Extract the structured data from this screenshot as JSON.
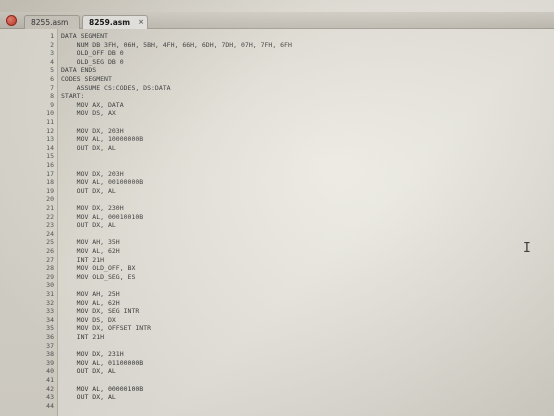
{
  "tabs": [
    {
      "label": "8255.asm"
    },
    {
      "label": "8259.asm",
      "active": true
    }
  ],
  "lines": [
    {
      "n": "1",
      "text": "DATA SEGMENT"
    },
    {
      "n": "2",
      "text": "    NUM DB 3FH, 06H, 5BH, 4FH, 66H, 6DH, 7DH, 07H, 7FH, 6FH"
    },
    {
      "n": "3",
      "text": "    OLD_OFF DB 0"
    },
    {
      "n": "4",
      "text": "    OLD_SEG DB 0"
    },
    {
      "n": "5",
      "text": "DATA ENDS"
    },
    {
      "n": "6",
      "text": "CODES SEGMENT"
    },
    {
      "n": "7",
      "text": "    ASSUME CS:CODES, DS:DATA"
    },
    {
      "n": "8",
      "text": "START:"
    },
    {
      "n": "9",
      "text": "    MOV AX, DATA"
    },
    {
      "n": "10",
      "text": "    MOV DS, AX"
    },
    {
      "n": "11",
      "text": ""
    },
    {
      "n": "12",
      "text": "    MOV DX, 203H"
    },
    {
      "n": "13",
      "text": "    MOV AL, 10000000B"
    },
    {
      "n": "14",
      "text": "    OUT DX, AL"
    },
    {
      "n": "15",
      "text": ""
    },
    {
      "n": "16",
      "text": ""
    },
    {
      "n": "17",
      "text": "    MOV DX, 203H"
    },
    {
      "n": "18",
      "text": "    MOV AL, 00100000B"
    },
    {
      "n": "19",
      "text": "    OUT DX, AL"
    },
    {
      "n": "20",
      "text": ""
    },
    {
      "n": "21",
      "text": "    MOV DX, 230H"
    },
    {
      "n": "22",
      "text": "    MOV AL, 00010010B"
    },
    {
      "n": "23",
      "text": "    OUT DX, AL"
    },
    {
      "n": "24",
      "text": ""
    },
    {
      "n": "25",
      "text": "    MOV AH, 35H"
    },
    {
      "n": "26",
      "text": "    MOV AL, 62H"
    },
    {
      "n": "27",
      "text": "    INT 21H"
    },
    {
      "n": "28",
      "text": "    MOV OLD_OFF, BX"
    },
    {
      "n": "29",
      "text": "    MOV OLD_SEG, ES"
    },
    {
      "n": "30",
      "text": ""
    },
    {
      "n": "31",
      "text": "    MOV AH, 25H"
    },
    {
      "n": "32",
      "text": "    MOV AL, 62H"
    },
    {
      "n": "33",
      "text": "    MOV DX, SEG INTR"
    },
    {
      "n": "34",
      "text": "    MOV DS, DX"
    },
    {
      "n": "35",
      "text": "    MOV DX, OFFSET INTR"
    },
    {
      "n": "36",
      "text": "    INT 21H"
    },
    {
      "n": "37",
      "text": ""
    },
    {
      "n": "38",
      "text": "    MOV DX, 231H"
    },
    {
      "n": "39",
      "text": "    MOV AL, 01100000B"
    },
    {
      "n": "40",
      "text": "    OUT DX, AL"
    },
    {
      "n": "41",
      "text": ""
    },
    {
      "n": "42",
      "text": "    MOV AL, 00000100B"
    },
    {
      "n": "43",
      "text": "    OUT DX, AL"
    },
    {
      "n": "44",
      "text": ""
    }
  ]
}
